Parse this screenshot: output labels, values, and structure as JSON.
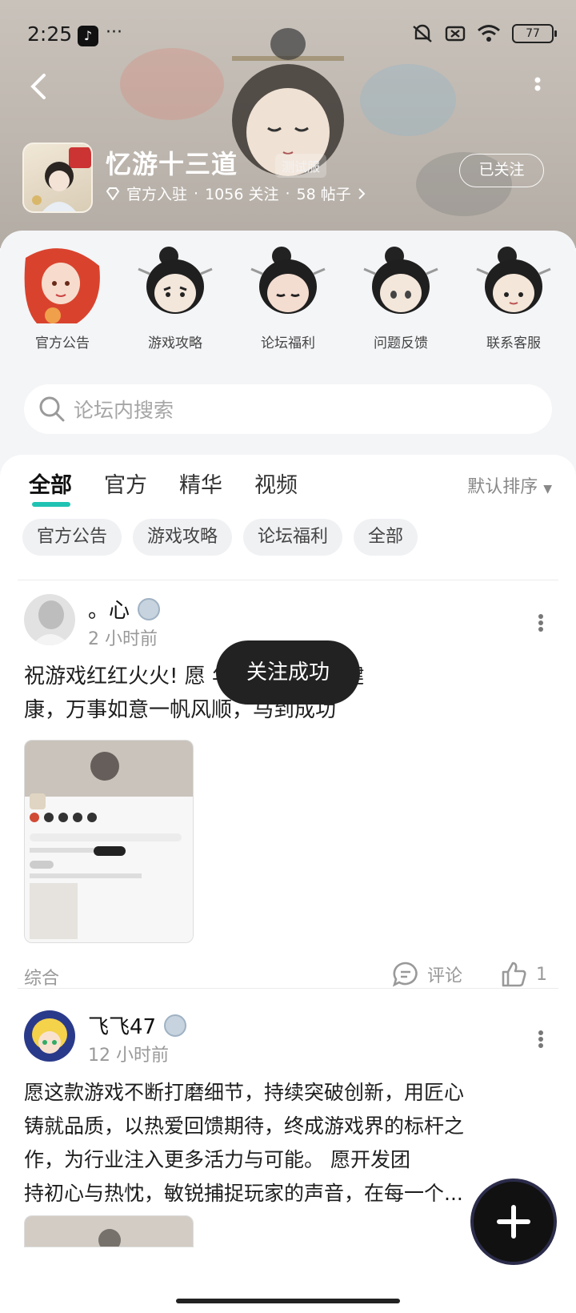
{
  "status_bar": {
    "time": "2:25",
    "battery": "77"
  },
  "header": {
    "game_title": "忆游十三道",
    "test_badge": "测试服",
    "official": "官方入驻",
    "followers": "1056 关注",
    "posts": "58 帖子",
    "follow_button": "已关注"
  },
  "quick_links": [
    {
      "label": "官方公告"
    },
    {
      "label": "游戏攻略"
    },
    {
      "label": "论坛福利"
    },
    {
      "label": "问题反馈"
    },
    {
      "label": "联系客服"
    }
  ],
  "search": {
    "placeholder": "论坛内搜索"
  },
  "tabs": [
    {
      "label": "全部"
    },
    {
      "label": "官方"
    },
    {
      "label": "精华"
    },
    {
      "label": "视频"
    }
  ],
  "sort_label": "默认排序",
  "chips": [
    {
      "label": "官方公告"
    },
    {
      "label": "游戏攻略"
    },
    {
      "label": "论坛福利"
    },
    {
      "label": "全部"
    }
  ],
  "posts": [
    {
      "author": "。心",
      "time": "2 小时前",
      "text_line1": "祝游戏红红火火! 愿 年快乐 ，身体健",
      "text_line2": "康，万事如意一帆风顺，马到成功",
      "category": "综合",
      "comment_label": "评论",
      "likes": "1"
    },
    {
      "author": "飞飞47",
      "time": "12 小时前",
      "text_line1": "愿这款游戏不断打磨细节，持续突破创新，用匠心",
      "text_line2": "铸就品质，以热爱回馈期待，终成游戏界的标杆之",
      "text_line3": "作，为行业注入更多活力与可能。 愿开发团",
      "text_line4": "持初心与热忱，敏锐捕捉玩家的声音，在每一个..."
    }
  ],
  "toast": "关注成功",
  "colors": {
    "accent": "#20c3b3",
    "toast_bg": "#222222"
  }
}
